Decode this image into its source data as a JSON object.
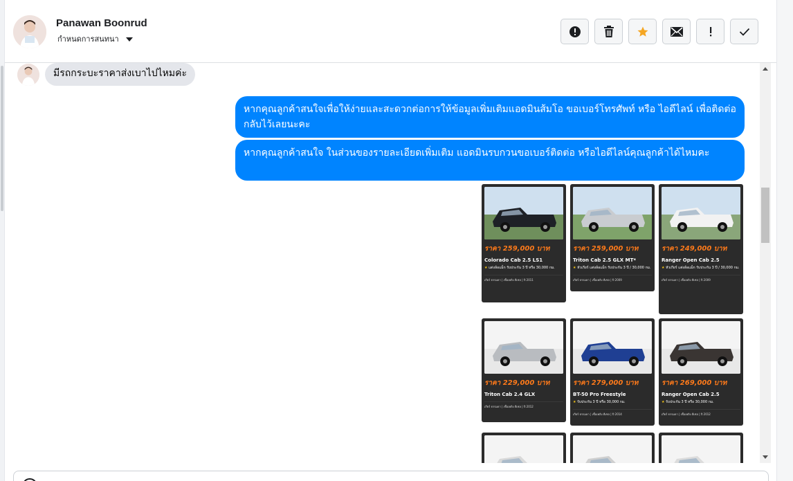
{
  "contact": {
    "name": "Panawan Boonrud",
    "assign_label": "กำหนดการสนทนา"
  },
  "actions": [
    {
      "name": "spam-button",
      "icon": "alert-circle-icon"
    },
    {
      "name": "delete-button",
      "icon": "trash-icon"
    },
    {
      "name": "star-button",
      "icon": "star-icon",
      "color": "#f5a623"
    },
    {
      "name": "mark-unread-button",
      "icon": "envelope-icon"
    },
    {
      "name": "follow-up-button",
      "icon": "exclamation-icon"
    },
    {
      "name": "done-button",
      "icon": "check-icon"
    }
  ],
  "messages": {
    "incoming_1": "มีรถกระบะราคาส่งเบาไปไหมค่ะ",
    "outgoing_1": "หากคุณลูกค้าสนใจเพื่อให้ง่ายและสะดวกต่อการให้ข้อมูลเพิ่มเติมแอดมินส้มโอ ขอเบอร์โทรศัพท์ หรือ ไอดีไลน์ เพื่อติดต่อกลับไว้เลยนะคะ",
    "outgoing_2": "หากคุณลูกค้าสนใจ ในส่วนของรายละเอียดเพิ่มเติม แอดมินรบกวนขอเบอร์ติดต่อ หรือไอดีไลน์คุณลูกค้าได้ไหมคะ"
  },
  "cars": [
    {
      "price": "ราคา 259,000 บาท",
      "model": "Colorado Cab 2.5 LS1",
      "feature": "แต่งล้อแม็ก รับประกัน 3 ปี หรือ 30,000 กม.",
      "footer": "เกียร์ ธรรมดา | เชื้อเพลิง ดีเซล | ปี 2011",
      "body": "#1e2126",
      "bg": "#6f8f5c"
    },
    {
      "price": "ราคา 259,000 บาท",
      "model": "Triton Cab 2.5 GLX MT*",
      "feature": "หัวเกียร์ แต่งล้อแม็ก รับประกัน 3 ปี / 30,000 กม.",
      "footer": "เกียร์ ธรรมดา | เชื้อเพลิง ดีเซล | ปี 2009",
      "body": "#c9ccd0",
      "bg": "#7fa36a"
    },
    {
      "price": "ราคา 249,000 บาท",
      "model": "Ranger Open Cab 2.5",
      "feature": "หัวเกียร์ แต่งล้อแม็ก รับประกัน 3 ปี / 30,000 กม.",
      "footer": "เกียร์ ธรรมดา | เชื้อเพลิง ดีเซล | ปี 2009",
      "body": "#f2f2f2",
      "bg": "#8aa67a"
    },
    {
      "price": "ราคา 229,000 บาท",
      "model": "Triton Cab 2.4 GLX",
      "feature": "",
      "footer": "เกียร์ ธรรมดา | เชื้อเพลิง ดีเซล | ปี 2012",
      "body": "#b9bcc0",
      "bg": "#e8e8e8"
    },
    {
      "price": "ราคา 279,000 บาท",
      "model": "BT-50 Pro Freestyle",
      "feature": "รับประกัน 3 ปี หรือ 30,000 กม.",
      "footer": "เกียร์ ธรรมดา | เชื้อเพลิง ดีเซล | ปี 2014",
      "body": "#1f3f93",
      "bg": "#e8e8e8"
    },
    {
      "price": "ราคา 269,000 บาท",
      "model": "Ranger Open Cab 2.5",
      "feature": "รับประกัน 3 ปี หรือ 30,000 กม.",
      "footer": "เกียร์ ธรรมดา | เชื้อเพลิง ดีเซล | ปี 2012",
      "body": "#3a3533",
      "bg": "#e8e8e8"
    },
    {
      "price": "",
      "model": "",
      "feature": "",
      "footer": "",
      "body": "#d9d9d9",
      "bg": "#f1f1f1"
    },
    {
      "price": "",
      "model": "",
      "feature": "",
      "footer": "",
      "body": "#cfcfcf",
      "bg": "#f1f1f1"
    },
    {
      "price": "",
      "model": "",
      "feature": "",
      "footer": "",
      "body": "#dcdcdc",
      "bg": "#f1f1f1"
    }
  ],
  "colors": {
    "outgoing_bubble": "#0084ff",
    "incoming_bubble": "#e4e6eb",
    "price": "#ff7a1a",
    "star": "#f5a623"
  }
}
